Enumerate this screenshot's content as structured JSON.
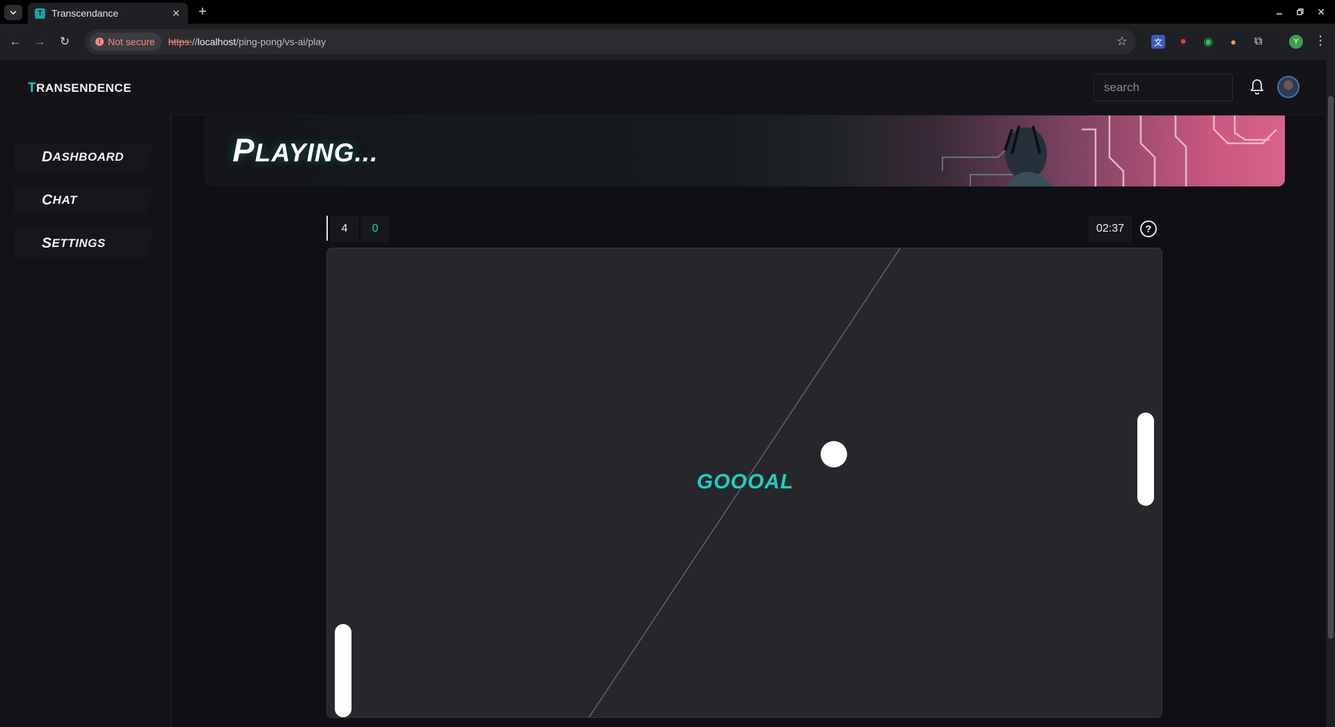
{
  "browser": {
    "tab_title": "Transcendance",
    "favicon_letter": "T",
    "not_secure_label": "Not secure",
    "url_scheme": "https:",
    "url_sep": "//",
    "url_host": "localhost",
    "url_path": "/ping-pong/vs-ai/play"
  },
  "header": {
    "logo_first": "T",
    "logo_rest": "RANSENDENCE",
    "search_placeholder": "search",
    "profile_initial": "Y"
  },
  "sidebar": {
    "items": [
      {
        "cap": "D",
        "rest": "ASHBOARD"
      },
      {
        "cap": "C",
        "rest": "HAT"
      },
      {
        "cap": "S",
        "rest": "ETTINGS"
      }
    ]
  },
  "banner": {
    "cap": "P",
    "rest": "LAYING..."
  },
  "game": {
    "score_player": "4",
    "score_opponent": "0",
    "timer": "02:37",
    "help_glyph": "?",
    "goal_text": "GOOOAL"
  },
  "colors": {
    "accent": "#19d2c0",
    "court": "#27272b",
    "background": "#0f1013"
  }
}
